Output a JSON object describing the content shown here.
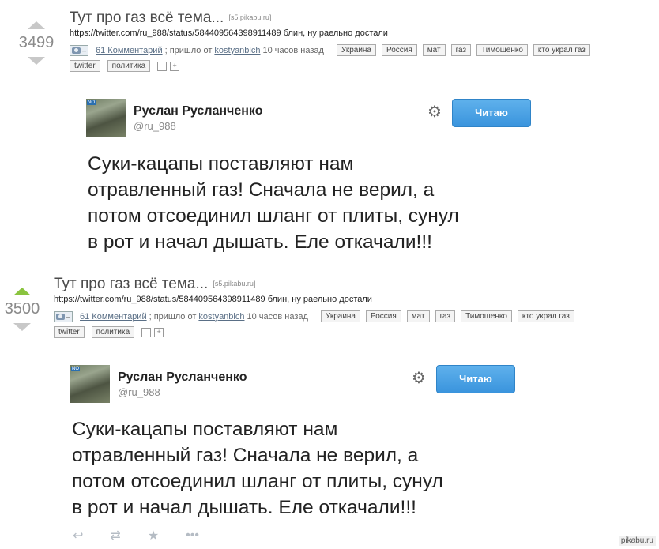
{
  "posts": [
    {
      "score": "3499",
      "title": "Тут про газ всё тема...",
      "source": "[s5.pikabu.ru]",
      "description": "https://twitter.com/ru_988/status/584409564398911489 блин, ну раельно достали",
      "comments": "61 Комментарий",
      "posted_prefix": "; пришло от",
      "author": "kostyanblch",
      "time": "10 часов назад",
      "tags": [
        "Украина",
        "Россия",
        "мат",
        "газ",
        "Тимошенко",
        "кто украл газ"
      ],
      "tags2": [
        "twitter",
        "политика"
      ],
      "tweet": {
        "name": "Руслан Русланченко",
        "handle": "@ru_988",
        "follow_label": "Читаю",
        "badge": "NO",
        "lines": [
          "Суки-кацапы поставляют нам",
          "отравленный газ! Сначала не верил, а",
          "потом отсоединил шланг от плиты, сунул",
          "в рот и начал дышать. Еле откачали!!!"
        ]
      }
    },
    {
      "score": "3500",
      "title": "Тут про газ всё тема...",
      "source": "[s5.pikabu.ru]",
      "description": "https://twitter.com/ru_988/status/584409564398911489 блин, ну раельно достали",
      "comments": "61 Комментарий",
      "posted_prefix": "; пришло от",
      "author": "kostyanblch",
      "time": "10 часов назад",
      "tags": [
        "Украина",
        "Россия",
        "мат",
        "газ",
        "Тимошенко",
        "кто украл газ"
      ],
      "tags2": [
        "twitter",
        "политика"
      ],
      "tweet": {
        "name": "Руслан Русланченко",
        "handle": "@ru_988",
        "follow_label": "Читаю",
        "badge": "NO",
        "lines": [
          "Суки-кацапы поставляют нам",
          "отравленный газ! Сначала не верил, а",
          "потом отсоединил шланг от плиты, сунул",
          "в рот и начал дышать. Еле откачали!!!"
        ]
      }
    }
  ],
  "camera_dash": "–",
  "watermark": "pikabu.ru",
  "icons": {
    "gear": "gear-icon",
    "reply": "reply-icon",
    "retweet": "retweet-icon",
    "favorite": "star-icon",
    "more": "more-icon"
  }
}
